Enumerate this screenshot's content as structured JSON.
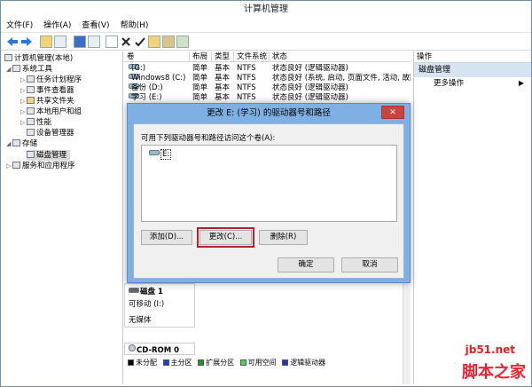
{
  "window": {
    "title": "计算机管理"
  },
  "menu": [
    "文件(F)",
    "操作(A)",
    "查看(V)",
    "帮助(H)"
  ],
  "toolbar_icons": [
    "back-arrow-icon",
    "forward-arrow-icon",
    "up-folder-icon",
    "console-tree-icon",
    "help-icon",
    "properties-icon",
    "new-icon",
    "delete-icon",
    "checkmark-icon",
    "open-folder-icon",
    "export-icon",
    "zoom-icon"
  ],
  "tree": {
    "root": "计算机管理(本地)",
    "system_tools": "系统工具",
    "task_scheduler": "任务计划程序",
    "event_viewer": "事件查看器",
    "shared_folders": "共享文件夹",
    "local_users": "本地用户和组",
    "performance": "性能",
    "device_manager": "设备管理器",
    "storage": "存储",
    "disk_management": "磁盘管理",
    "services": "服务和应用程序"
  },
  "columns": [
    "卷",
    "布局",
    "类型",
    "文件系统",
    "状态"
  ],
  "volumes": [
    {
      "name": "(G:)",
      "layout": "简单",
      "type": "基本",
      "fs": "NTFS",
      "status": "状态良好 (逻辑驱动器)"
    },
    {
      "name": "Windows8 (C:)",
      "layout": "简单",
      "type": "基本",
      "fs": "NTFS",
      "status": "状态良好 (系统, 启动, 页面文件, 活动, 故障"
    },
    {
      "name": "备份 (D:)",
      "layout": "简单",
      "type": "基本",
      "fs": "NTFS",
      "status": "状态良好 (逻辑驱动器)"
    },
    {
      "name": "学习 (E:)",
      "layout": "简单",
      "type": "基本",
      "fs": "NTFS",
      "status": "状态良好 (逻辑驱动器)"
    }
  ],
  "actions": {
    "header": "操作",
    "selected": "磁盘管理",
    "more": "更多操作"
  },
  "disks": [
    {
      "name": "磁盘 1",
      "line2": "可移动 (I:)",
      "line3": "无媒体"
    },
    {
      "name": "CD-ROM 0"
    }
  ],
  "legend": [
    {
      "label": "未分配",
      "color": "#000000"
    },
    {
      "label": "主分区",
      "color": "#1a3bd0"
    },
    {
      "label": "扩展分区",
      "color": "#1c9b1c"
    },
    {
      "label": "可用空间",
      "color": "#4ad64a"
    },
    {
      "label": "逻辑驱动器",
      "color": "#2233bb"
    }
  ],
  "dialog": {
    "title": "更改 E: (学习) 的驱动器号和路径",
    "close": "✕",
    "label": "可用下列驱动器号和路径访问这个卷(A):",
    "list_item": "E:",
    "add": "添加(D)...",
    "change": "更改(C)...",
    "delete": "删除(R)",
    "ok": "确定",
    "cancel": "取消"
  },
  "watermark": {
    "site": "jb51.net",
    "brand": "脚本之家"
  },
  "colors": {
    "accent": "#7eb0e4",
    "highlight": "#b3222c",
    "close": "#c7463c"
  }
}
